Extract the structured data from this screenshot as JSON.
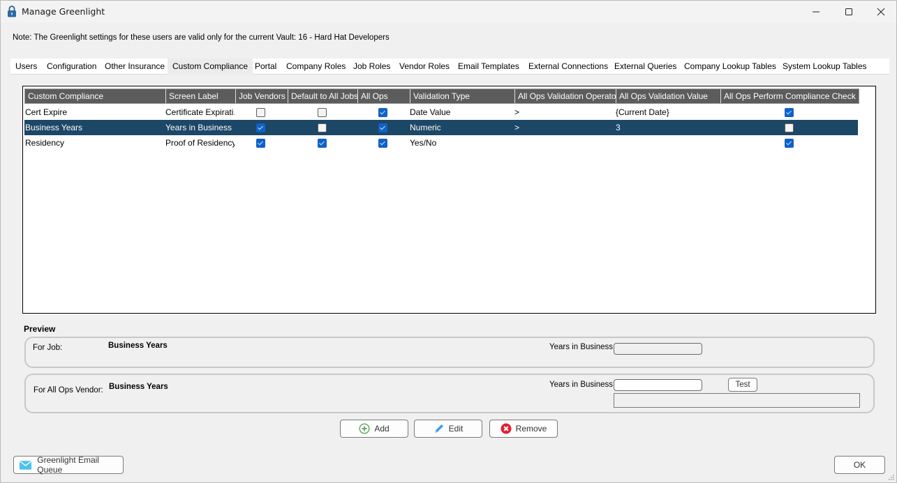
{
  "window": {
    "title": "Manage Greenlight",
    "icon": "lock-icon",
    "controls": [
      "minimize",
      "maximize",
      "close"
    ]
  },
  "note": "Note:  The Greenlight settings for these users are valid only for the current Vault: 16 - Hard Hat Developers",
  "tabs": [
    {
      "label": "Users",
      "active": false
    },
    {
      "label": "Configuration",
      "active": false
    },
    {
      "label": "Other Insurance",
      "active": false
    },
    {
      "label": "Custom Compliance",
      "active": true
    },
    {
      "label": "Portal",
      "active": false
    },
    {
      "label": "Company Roles",
      "active": false
    },
    {
      "label": "Job Roles",
      "active": false
    },
    {
      "label": "Vendor Roles",
      "active": false
    },
    {
      "label": "Email Templates",
      "active": false
    },
    {
      "label": "External Connections",
      "active": false
    },
    {
      "label": "External Queries",
      "active": false
    },
    {
      "label": "Company Lookup Tables",
      "active": false
    },
    {
      "label": "System Lookup Tables",
      "active": false
    }
  ],
  "grid": {
    "columns": [
      "Custom Compliance",
      "Screen Label",
      "Job Vendors",
      "Default to All Jobs",
      "All Ops",
      "Validation Type",
      "All Ops Validation Operator",
      "All Ops Validation Value",
      "All Ops Perform Compliance Check"
    ],
    "rows": [
      {
        "name": "Cert Expire",
        "screen_label": "Certificate Expirati...",
        "job_vendors": false,
        "default_all_jobs": false,
        "all_ops": true,
        "validation_type": "Date Value",
        "operator": ">",
        "value": "{Current Date}",
        "perform_check": true,
        "selected": false
      },
      {
        "name": "Business Years",
        "screen_label": "Years in Business",
        "job_vendors": true,
        "default_all_jobs": false,
        "all_ops": true,
        "validation_type": "Numeric",
        "operator": ">",
        "value": "3",
        "perform_check": false,
        "selected": true
      },
      {
        "name": "Residency",
        "screen_label": "Proof of Residency",
        "job_vendors": true,
        "default_all_jobs": true,
        "all_ops": true,
        "validation_type": "Yes/No",
        "operator": "",
        "value": "",
        "perform_check": true,
        "selected": false
      }
    ]
  },
  "preview": {
    "heading": "Preview",
    "for_job": {
      "label": "For Job:",
      "name": "Business Years",
      "field_label": "Years in Business",
      "field_value": ""
    },
    "for_all_ops": {
      "label": "For All Ops Vendor:",
      "name": "Business Years",
      "field_label": "Years in Business",
      "field_value": "",
      "test_label": "Test",
      "result": ""
    }
  },
  "actions": {
    "add": "Add",
    "edit": "Edit",
    "remove": "Remove"
  },
  "footer": {
    "email_queue": "Greenlight Email Queue",
    "ok": "OK"
  },
  "colors": {
    "selected_row": "#1c4766",
    "header_bg": "#5c5c5c",
    "checkbox_on": "#0f62c8",
    "add_icon": "#6aaa6a",
    "edit_icon": "#3d9be9",
    "remove_icon": "#e02030",
    "email_icon": "#4fc1ee"
  }
}
